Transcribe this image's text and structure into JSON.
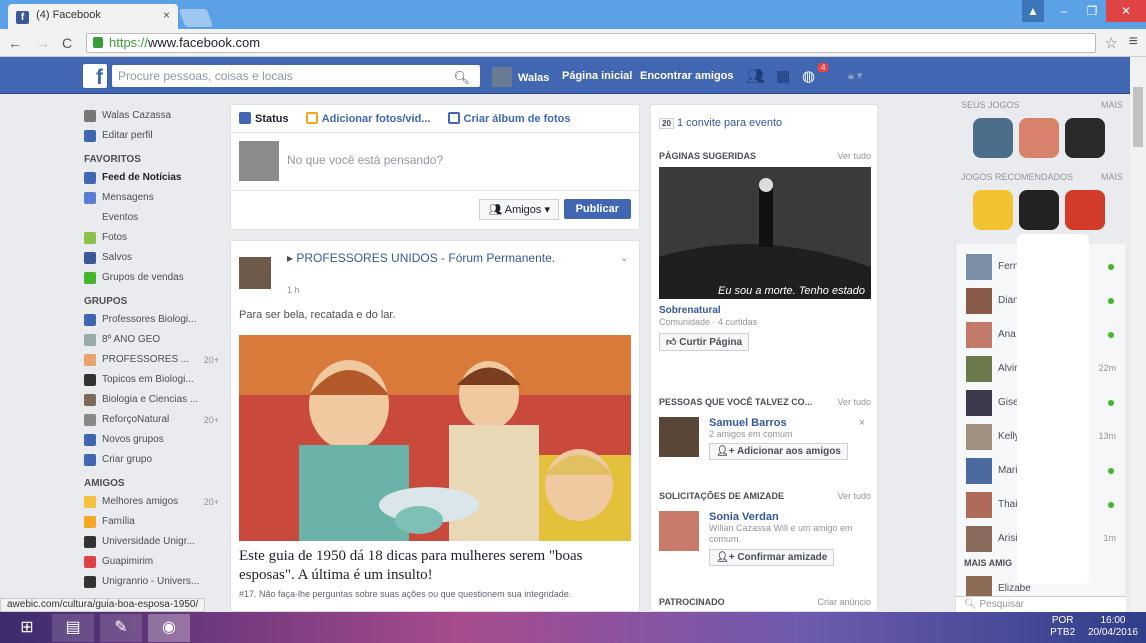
{
  "browser": {
    "tab_title": "(4) Facebook",
    "url_scheme": "https://",
    "url_host": "www.facebook.com"
  },
  "header": {
    "search_placeholder": "Procure pessoas, coisas e locais",
    "user": "Walas",
    "home": "Página inicial",
    "find_friends": "Encontrar amigos",
    "notif_count": "4"
  },
  "left_nav": {
    "profile": "Walas Cazassa",
    "edit": "Editar perfil",
    "favorites_title": "FAVORITOS",
    "favorites": [
      {
        "label": "Feed de Notícias",
        "count": ""
      },
      {
        "label": "Mensagens",
        "count": ""
      },
      {
        "label": "Eventos",
        "count": ""
      },
      {
        "label": "Fotos",
        "count": ""
      },
      {
        "label": "Salvos",
        "count": ""
      },
      {
        "label": "Grupos de vendas",
        "count": ""
      }
    ],
    "groups_title": "GRUPOS",
    "groups": [
      {
        "label": "Professores Biologi...",
        "count": ""
      },
      {
        "label": "8º ANO GEO",
        "count": ""
      },
      {
        "label": "PROFESSORES ...",
        "count": "20+"
      },
      {
        "label": "Topicos em Biologi...",
        "count": ""
      },
      {
        "label": "Biologia e Ciencias ...",
        "count": ""
      },
      {
        "label": "ReforçoNatural",
        "count": "20+"
      },
      {
        "label": "Novos grupos",
        "count": ""
      },
      {
        "label": "Criar grupo",
        "count": ""
      }
    ],
    "friends_title": "AMIGOS",
    "friends": [
      {
        "label": "Melhores amigos",
        "count": "20+"
      },
      {
        "label": "Família",
        "count": ""
      },
      {
        "label": "Universidade Unigr...",
        "count": ""
      },
      {
        "label": "Guapimirim",
        "count": ""
      },
      {
        "label": "Unigranrio - Univers...",
        "count": ""
      }
    ]
  },
  "composer": {
    "tab_status": "Status",
    "tab_photos": "Adicionar fotos/vid...",
    "tab_album": "Criar álbum de fotos",
    "placeholder": "No que você está pensando?",
    "audience": "Amigos",
    "publish": "Publicar"
  },
  "post": {
    "group": "PROFESSORES UNIDOS - Fórum Permanente.",
    "time": "1 h",
    "text": "Para ser bela, recatada e do lar.",
    "title": "Este guia de 1950 dá 18 dicas para mulheres serem \"boas esposas\". A última é um insulto!",
    "sub": "#17. Não faça-lhe perguntas sobre suas ações ou que questionem sua integridade."
  },
  "mid": {
    "invite": "1 convite para evento",
    "invite_icon": "20",
    "suggested_title": "PÁGINAS SUGERIDAS",
    "see_all": "Ver tudo",
    "page_caption": "Eu sou a morte. Tenho estado",
    "page_name": "Sobrenatural",
    "page_meta": "Comunidade · 4 curtidas",
    "like_btn": "Curtir Página",
    "pymk_title": "PESSOAS QUE VOCÊ TALVEZ CO...",
    "pymk_name": "Samuel Barros",
    "pymk_meta": "2 amigos em comum",
    "pymk_btn": "Adicionar aos amigos",
    "req_title": "SOLICITAÇÕES DE AMIZADE",
    "req_name": "Sonia Verdan",
    "req_meta": "Wilian Cazassa Will e um amigo em comum.",
    "req_btn": "Confirmar amizade",
    "sponsored": "PATROCINADO",
    "create_ad": "Criar anúncio"
  },
  "games": {
    "title": "SEUS JOGOS",
    "more": "MAIS",
    "rec_title": "JOGOS RECOMENDADOS",
    "rec_more": "MAIS"
  },
  "chat": {
    "contacts": [
      {
        "name": "Fern",
        "status": "dot"
      },
      {
        "name": "Dian",
        "status": "dot"
      },
      {
        "name": "Ana",
        "status": "dot"
      },
      {
        "name": "Alvir",
        "status": "22m"
      },
      {
        "name": "Gise",
        "status": "dot"
      },
      {
        "name": "Kelly",
        "status": "13m"
      },
      {
        "name": "Mari",
        "status": "dot"
      },
      {
        "name": "Thai",
        "status": "dot"
      },
      {
        "name": "Arisi",
        "status": "1m"
      }
    ],
    "more_friends": "MAIS AMIG",
    "last": "Elizabe",
    "search": "Pesquisar"
  },
  "status_url": "awebic.com/cultura/guia-boa-esposa-1950/",
  "tray": {
    "lang": "POR",
    "layout": "PTB2",
    "time": "16:00",
    "date": "20/04/2016"
  }
}
